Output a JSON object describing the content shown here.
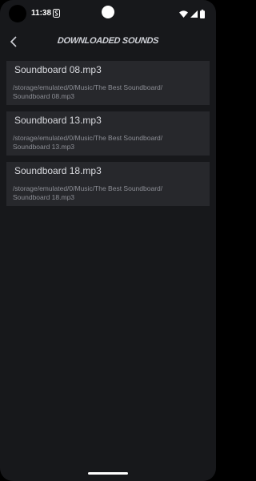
{
  "status_bar": {
    "time": "11:38"
  },
  "toolbar": {
    "title": "DOWNLOADED SOUNDS"
  },
  "files": [
    {
      "name": "Soundboard 08.mp3",
      "path": "/storage/emulated/0/Music/The Best Soundboard/\nSoundboard 08.mp3"
    },
    {
      "name": "Soundboard 13.mp3",
      "path": "/storage/emulated/0/Music/The Best Soundboard/\nSoundboard 13.mp3"
    },
    {
      "name": "Soundboard 18.mp3",
      "path": "/storage/emulated/0/Music/The Best Soundboard/\nSoundboard 18.mp3"
    }
  ],
  "colors": {
    "background": "#17181b",
    "card": "#27282c",
    "title": "#d0d2d8",
    "file_name": "#dadbe0",
    "file_path": "#8c8e95"
  },
  "icons": {
    "back": "arrow-back-icon",
    "notification": "notification-s-icon",
    "wifi": "wifi-icon",
    "signal": "cell-signal-icon",
    "battery": "battery-icon"
  }
}
